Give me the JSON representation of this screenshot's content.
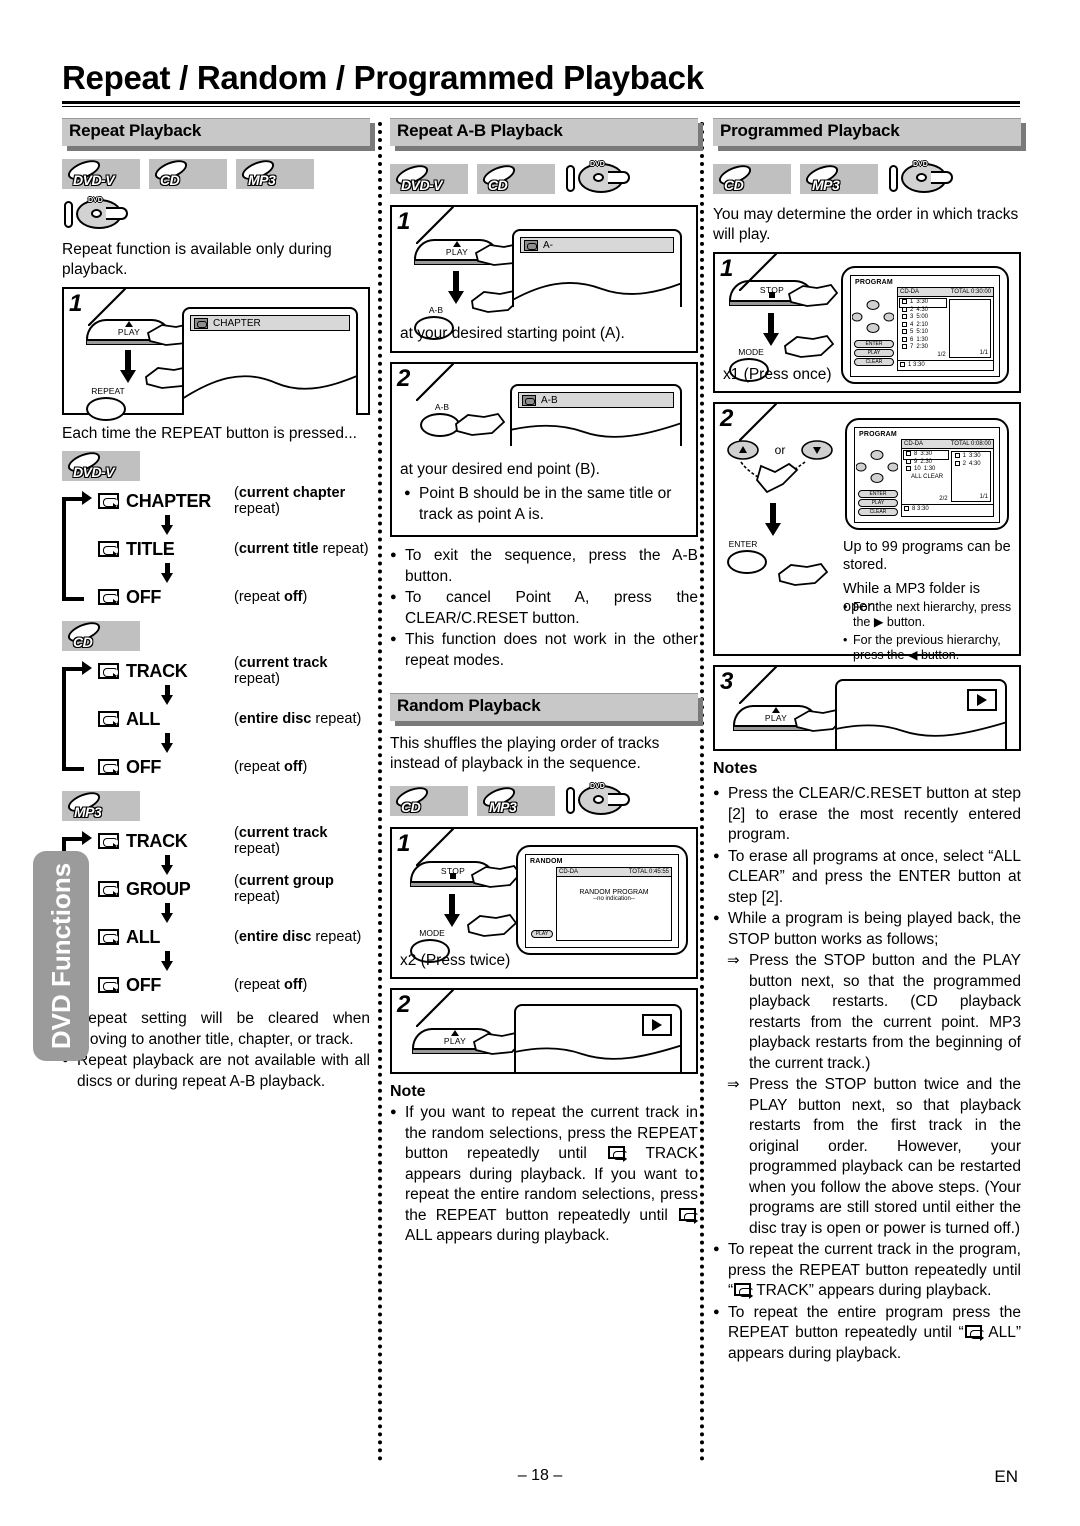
{
  "page": {
    "title": "Repeat / Random / Programmed Playback",
    "page_number": "– 18 –",
    "language_code": "EN",
    "side_tab": "DVD Functions"
  },
  "left_column": {
    "heading": "Repeat Playback",
    "badges": [
      "DVD-V",
      "CD",
      "MP3"
    ],
    "disc_icon": "dvd-disc-icon",
    "intro": "Repeat function is available only during playback.",
    "step1": {
      "number": "1",
      "button_top": "PLAY",
      "button_bottom": "REPEAT",
      "osd_label": "CHAPTER"
    },
    "after_step": "Each time the REPEAT button is pressed...",
    "chains": [
      {
        "media": "DVD-V",
        "items": [
          {
            "mode": "CHAPTER",
            "desc_bold": "current chapter",
            "desc_rest": " repeat"
          },
          {
            "mode": "TITLE",
            "desc_bold": "current title",
            "desc_rest": " repeat"
          },
          {
            "mode": "OFF",
            "desc_bold_tail": "off",
            "desc_lead": "repeat "
          }
        ]
      },
      {
        "media": "CD",
        "items": [
          {
            "mode": "TRACK",
            "desc_bold": "current track",
            "desc_rest": " repeat"
          },
          {
            "mode": "ALL",
            "desc_bold": "entire disc",
            "desc_rest": " repeat"
          },
          {
            "mode": "OFF",
            "desc_bold_tail": "off",
            "desc_lead": "repeat "
          }
        ]
      },
      {
        "media": "MP3",
        "items": [
          {
            "mode": "TRACK",
            "desc_bold": "current track",
            "desc_rest": " repeat"
          },
          {
            "mode": "GROUP",
            "desc_bold": "current group",
            "desc_rest": " repeat"
          },
          {
            "mode": "ALL",
            "desc_bold": "entire disc",
            "desc_rest": " repeat"
          },
          {
            "mode": "OFF",
            "desc_bold_tail": "off",
            "desc_lead": "repeat "
          }
        ]
      }
    ],
    "bullets": [
      "Repeat setting will be cleared when moving to another title, chapter, or track.",
      "Repeat playback are not available with all discs or during repeat A-B playback."
    ]
  },
  "mid_column": {
    "heading": "Repeat A-B Playback",
    "badges": [
      "DVD-V",
      "CD"
    ],
    "disc_icon": "dvd-disc-icon",
    "step1": {
      "number": "1",
      "button_top": "PLAY",
      "button_bottom": "A-B",
      "osd_label": "A-",
      "caption": "at your desired starting point (A)."
    },
    "step2": {
      "number": "2",
      "button": "A-B",
      "osd_label": "A-B",
      "caption": "at your desired end point (B).",
      "bullet": "Point B should be in the same title or track as point A is."
    },
    "bullets": [
      "To exit the sequence, press the A-B button.",
      "To cancel Point A, press the CLEAR/C.RESET button.",
      "This function does not work in the other repeat modes."
    ],
    "random": {
      "heading": "Random Playback",
      "badges": [
        "CD",
        "MP3"
      ],
      "disc_icon": "dvd-disc-icon",
      "intro": "This shuffles the playing order of tracks instead of playback in the sequence.",
      "step1": {
        "number": "1",
        "button_top": "STOP",
        "button_bottom": "MODE",
        "caption": "x2 (Press twice)",
        "screen": {
          "title": "RANDOM",
          "disc_type": "CD-DA",
          "total": "TOTAL 0:45:55",
          "line1": "RANDOM PROGRAM",
          "line2": "--no indication--",
          "pill": "PLAY"
        }
      },
      "step2": {
        "number": "2",
        "button": "PLAY",
        "osd_icon": "play-icon"
      }
    },
    "note": {
      "heading": "Note",
      "bullet_part1": "If you want to repeat the current track in the random selections, press the REPEAT button repeatedly until",
      "bullet_part2": "TRACK appears during playback. If you want to repeat the entire random selections, press the REPEAT button repeatedly until",
      "bullet_part3": "ALL appears during playback."
    }
  },
  "right_column": {
    "heading": "Programmed Playback",
    "badges": [
      "CD",
      "MP3"
    ],
    "disc_icon": "dvd-disc-icon",
    "intro": "You may determine the order in which tracks will play.",
    "step1": {
      "number": "1",
      "button_top": "STOP",
      "button_bottom": "MODE",
      "caption": "x1 (Press once)",
      "screen": {
        "title": "PROGRAM",
        "disc_type": "CD-DA",
        "total": "TOTAL 0:30:00",
        "tracks": [
          {
            "no": "1",
            "time": "3:30"
          },
          {
            "no": "2",
            "time": "4:30"
          },
          {
            "no": "3",
            "time": "5:00"
          },
          {
            "no": "4",
            "time": "2:10"
          },
          {
            "no": "5",
            "time": "5:10"
          },
          {
            "no": "6",
            "time": "1:30"
          },
          {
            "no": "7",
            "time": "2:30"
          }
        ],
        "page_left": "1/2",
        "page_right": "1/1",
        "footer_track": "1  3:30",
        "pills": [
          "ENTER",
          "PLAY",
          "CLEAR"
        ]
      }
    },
    "step2": {
      "number": "2",
      "or_label": "or",
      "button": "ENTER",
      "text1": "Up to 99 programs can be stored.",
      "text2": "While a MP3 folder is open:",
      "bullets": [
        "For the next hierarchy, press the ▶ button.",
        "For the previous hierarchy, press the ◀ button."
      ],
      "screen": {
        "title": "PROGRAM",
        "disc_type": "CD-DA",
        "total": "TOTAL 0:08:00",
        "tracks": [
          {
            "no": "8",
            "time": "3:30"
          },
          {
            "no": "9",
            "time": "2:30"
          },
          {
            "no": "10",
            "time": "1:30"
          }
        ],
        "all_clear": "ALL CLEAR",
        "programmed": [
          {
            "no": "1",
            "time": "3:30"
          },
          {
            "no": "2",
            "time": "4:30"
          }
        ],
        "page_left": "2/2",
        "page_right": "1/1",
        "footer_track": "8  3:30"
      }
    },
    "step3": {
      "number": "3",
      "button": "PLAY",
      "osd_icon": "play-icon"
    },
    "notes": {
      "heading": "Notes",
      "items": [
        {
          "type": "bullet",
          "text": "Press the CLEAR/C.RESET button at step [2] to erase the most recently entered program."
        },
        {
          "type": "bullet",
          "text": "To erase all programs at once, select “ALL CLEAR” and press the ENTER button at step [2]."
        },
        {
          "type": "bullet",
          "text": "While a program is being played back, the STOP button works as follows;"
        },
        {
          "type": "arrow",
          "text": "Press the STOP button and the PLAY button next, so that the programmed playback restarts. (CD playback restarts from the current point. MP3 playback restarts from the beginning of the current track.)"
        },
        {
          "type": "arrow",
          "text": "Press the STOP button twice and the PLAY button next, so that playback restarts from the first track in the original order. However, your programmed playback can be restarted when you follow the above steps. (Your programs are still stored until either the disc tray is open or power is turned off.)"
        },
        {
          "type": "bullet_icon",
          "pre": "To repeat the current track in the program, press the REPEAT button repeatedly until “",
          "post": " TRACK” appears during playback."
        },
        {
          "type": "bullet_icon",
          "pre": "To repeat the entire program press the REPEAT button repeatedly until “",
          "post": " ALL” appears during playback."
        }
      ]
    }
  }
}
